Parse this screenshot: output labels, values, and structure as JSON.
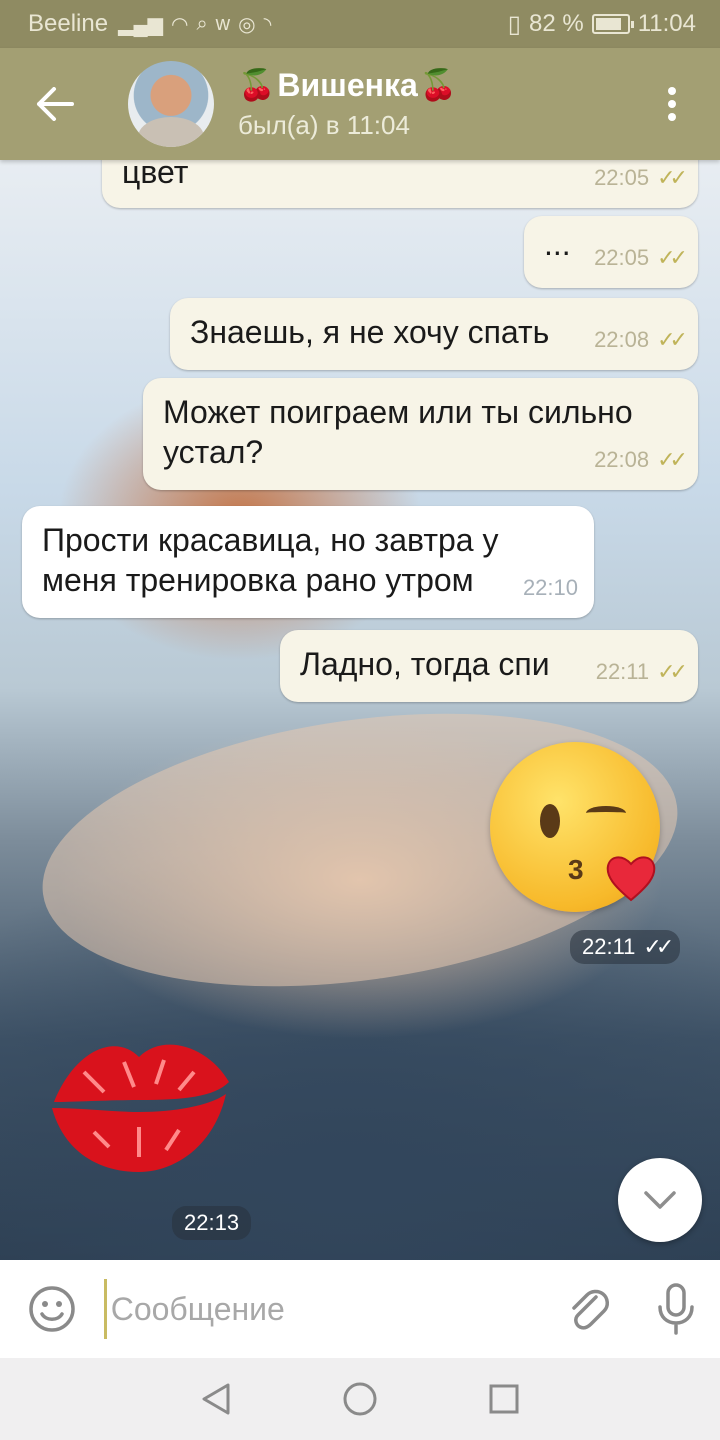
{
  "status_bar": {
    "carrier": "Beeline",
    "battery_percent_text": "82 %",
    "battery_level": 0.82,
    "time": "11:04"
  },
  "header": {
    "contact_name": "Вишенка",
    "status": "был(а) в 11:04"
  },
  "messages": [
    {
      "side": "out",
      "text": "цвет",
      "time": "22:05",
      "read": true
    },
    {
      "side": "out",
      "text": "...",
      "time": "22:05",
      "read": true
    },
    {
      "side": "out",
      "text": "Знаешь, я не хочу спать",
      "time": "22:08",
      "read": true
    },
    {
      "side": "out",
      "text_line1": "Может поиграем или ты сильно",
      "text_line2": "устал?",
      "time": "22:08",
      "read": true
    },
    {
      "side": "in",
      "text_line1": "Прости красавица, но завтра у",
      "text_line2": "меня тренировка рано утром",
      "time": "22:10"
    },
    {
      "side": "out",
      "text": "Ладно, тогда спи",
      "time": "22:11",
      "read": true
    },
    {
      "side": "out",
      "sticker": "kissing-face-emoji",
      "time": "22:11",
      "read": true
    },
    {
      "side": "in",
      "sticker": "red-lips-kiss",
      "time": "22:13"
    }
  ],
  "input": {
    "placeholder": "Сообщение"
  },
  "colors": {
    "header": "#a39f73",
    "status_bar": "#8f8b62",
    "outgoing_bubble": "#f7f4e7",
    "incoming_bubble": "#ffffff",
    "check_marks": "#c0b45a",
    "cursor": "#c9bb62"
  },
  "icons": {
    "back": "arrow-left-icon",
    "menu": "more-vertical-icon",
    "emoji": "smile-icon",
    "attach": "paperclip-icon",
    "mic": "microphone-icon",
    "scroll_down": "chevron-down-icon",
    "nav_back": "triangle-back-icon",
    "nav_home": "circle-home-icon",
    "nav_recents": "square-recents-icon"
  }
}
